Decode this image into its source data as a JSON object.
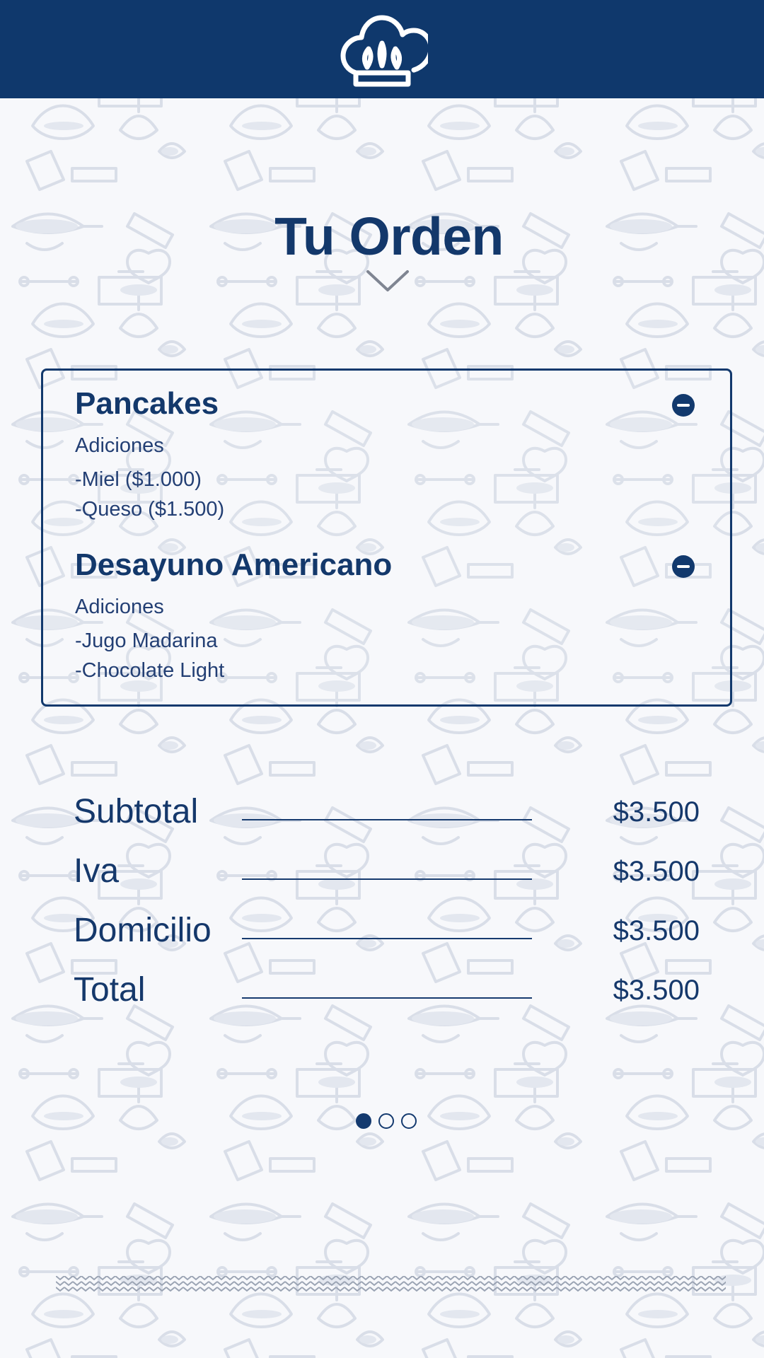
{
  "header": {
    "logo_icon": "chef-hat-icon"
  },
  "page": {
    "title": "Tu Orden"
  },
  "order": {
    "items": [
      {
        "name": "Pancakes",
        "addons_title": "Adiciones",
        "addons": [
          "-Miel ($1.000)",
          "-Queso ($1.500)"
        ],
        "remove_icon": "minus-circle-icon"
      },
      {
        "name": "Desayuno Americano",
        "addons_title": "Adiciones",
        "addons": [
          "-Jugo Madarina",
          "-Chocolate Light"
        ],
        "remove_icon": "minus-circle-icon"
      }
    ]
  },
  "summary": [
    {
      "label": "Subtotal",
      "value": "$3.500"
    },
    {
      "label": "Iva",
      "value": "$3.500"
    },
    {
      "label": "Domicilio",
      "value": "$3.500"
    },
    {
      "label": "Total",
      "value": "$3.500"
    }
  ],
  "pagination": {
    "active_index": 0,
    "count": 3
  },
  "colors": {
    "primary": "#0f386c",
    "background": "#f7f8fb",
    "pattern": "#d9dee8"
  }
}
